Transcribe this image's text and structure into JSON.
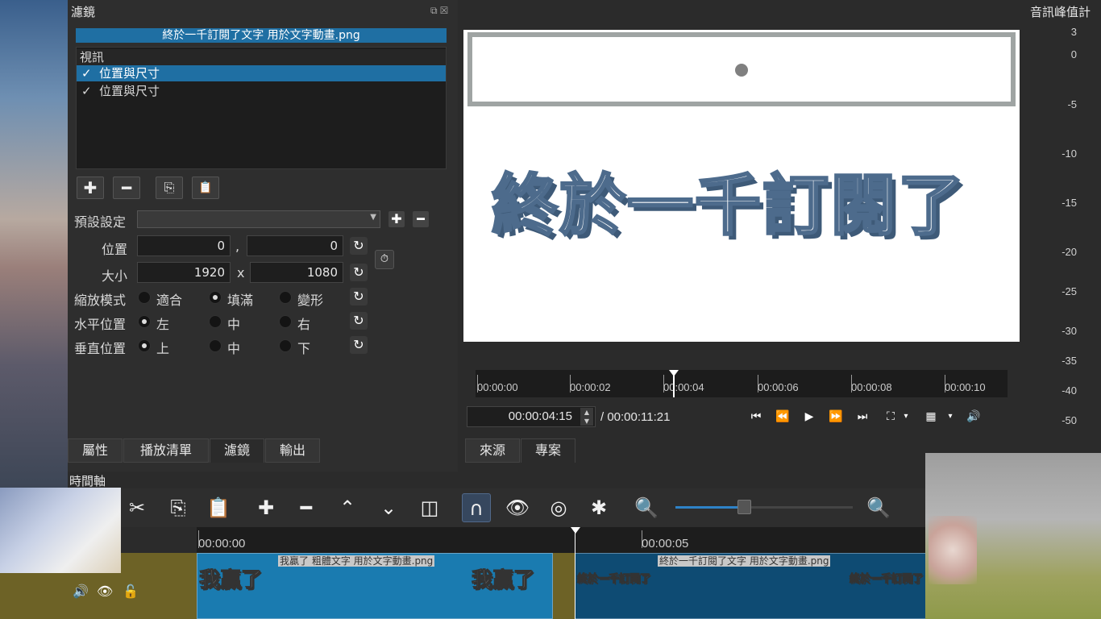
{
  "filters_panel": {
    "title": "濾鏡",
    "title_icons": "⧉☒",
    "clip_name": "終於一千訂閱了文字 用於文字動畫.png",
    "list_header": "視訊",
    "items": [
      {
        "check": "✓",
        "label": "位置與尺寸",
        "selected": true
      },
      {
        "check": "✓",
        "label": "位置與尺寸",
        "selected": false
      }
    ],
    "toolbar": {
      "add": "✚",
      "remove": "━",
      "copy": "⎘",
      "paste": "📋"
    },
    "preset_label": "預設設定",
    "preset_add": "✚",
    "preset_remove": "━",
    "position_label": "位置",
    "position_x": "0",
    "position_sep": ",",
    "position_y": "0",
    "size_label": "大小",
    "size_w": "1920",
    "size_sep": "x",
    "size_h": "1080",
    "scale_mode_label": "縮放模式",
    "scale_options": [
      "適合",
      "填滿",
      "變形"
    ],
    "h_position_label": "水平位置",
    "h_options": [
      "左",
      "中",
      "右"
    ],
    "v_position_label": "垂直位置",
    "v_options": [
      "上",
      "中",
      "下"
    ],
    "reset_glyph": "↻",
    "keyframe_glyph": "⏱"
  },
  "left_tabs": [
    "屬性",
    "播放清單",
    "濾鏡",
    "輸出"
  ],
  "viewer": {
    "preview_text": "終於一千訂閱了",
    "ruler_ticks": [
      "00:00:00",
      "00:00:02",
      "00:00:04",
      "00:00:06",
      "00:00:08",
      "00:00:10"
    ],
    "timecode": "00:00:04:15",
    "duration": "/ 00:00:11:21",
    "transport": [
      "⏮",
      "⏪",
      "▶",
      "⏩",
      "⏭",
      "⛶",
      "▾",
      "▦",
      "▾",
      "🔊"
    ],
    "tabs": [
      "來源",
      "專案"
    ]
  },
  "meter": {
    "title": "音訊峰值計",
    "labels": [
      "3",
      "0",
      "-5",
      "-10",
      "-15",
      "-20",
      "-25",
      "-30",
      "-35",
      "-40",
      "-50"
    ]
  },
  "timeline": {
    "title": "時間軸",
    "toolbar": [
      "✂",
      "⎘",
      "📋",
      "✚",
      "━",
      "⌃",
      "⌄",
      "◫",
      "∩",
      "👁",
      "◎",
      "✱",
      "🔍",
      "🔍"
    ],
    "ruler_ticks": [
      "00:00:00",
      "00:00:05"
    ],
    "track_icons": [
      "🔊",
      "👁",
      "🔓"
    ],
    "clip1_label": "我贏了 粗體文字 用於文字動畫.png",
    "clip1_thumb": "我贏了",
    "clip2_label": "終於一千訂閱了文字 用於文字動畫.png",
    "clip2_thumb": "終於一千訂閱了"
  }
}
